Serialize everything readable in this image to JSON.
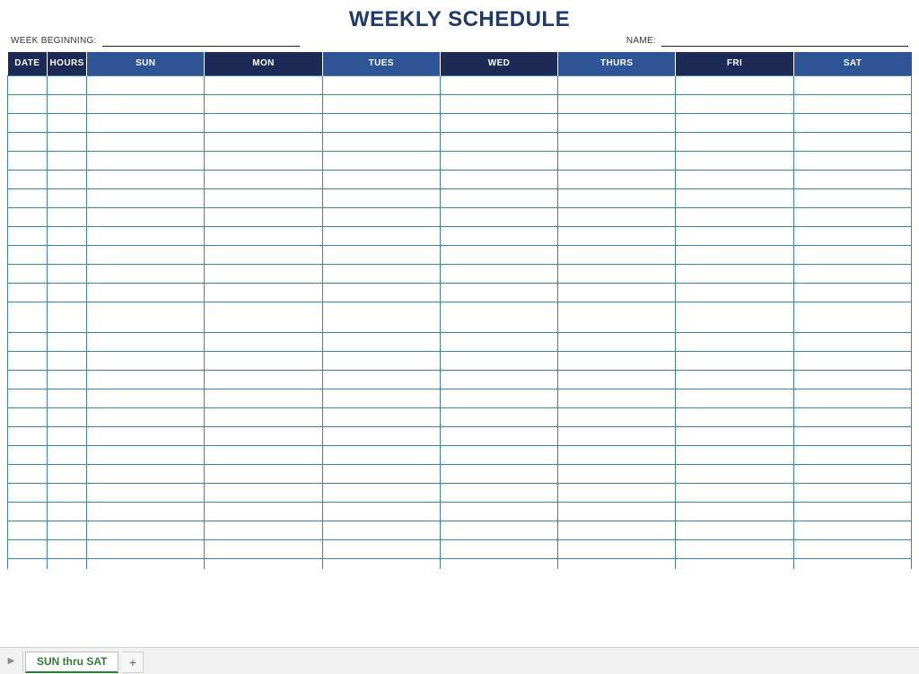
{
  "title": "WEEKLY SCHEDULE",
  "meta": {
    "week_beginning_label": "WEEK BEGINNING:",
    "week_beginning_value": "",
    "name_label": "NAME:",
    "name_value": ""
  },
  "headers": {
    "date": "DATE",
    "hours": "HOURS",
    "sun": "SUN",
    "mon": "MON",
    "tues": "TUES",
    "wed": "WED",
    "thurs": "THURS",
    "fri": "FRI",
    "sat": "SAT"
  },
  "row_count": 26,
  "tabbar": {
    "nav_icon": "▶",
    "sheet_name": "SUN thru SAT",
    "add_label": "+"
  },
  "colors": {
    "title": "#1f3a68",
    "header_dark": "#1e2a56",
    "header_alt": "#2f5597",
    "cell_border": "#3d82a7",
    "tab_accent": "#2e7d32"
  }
}
